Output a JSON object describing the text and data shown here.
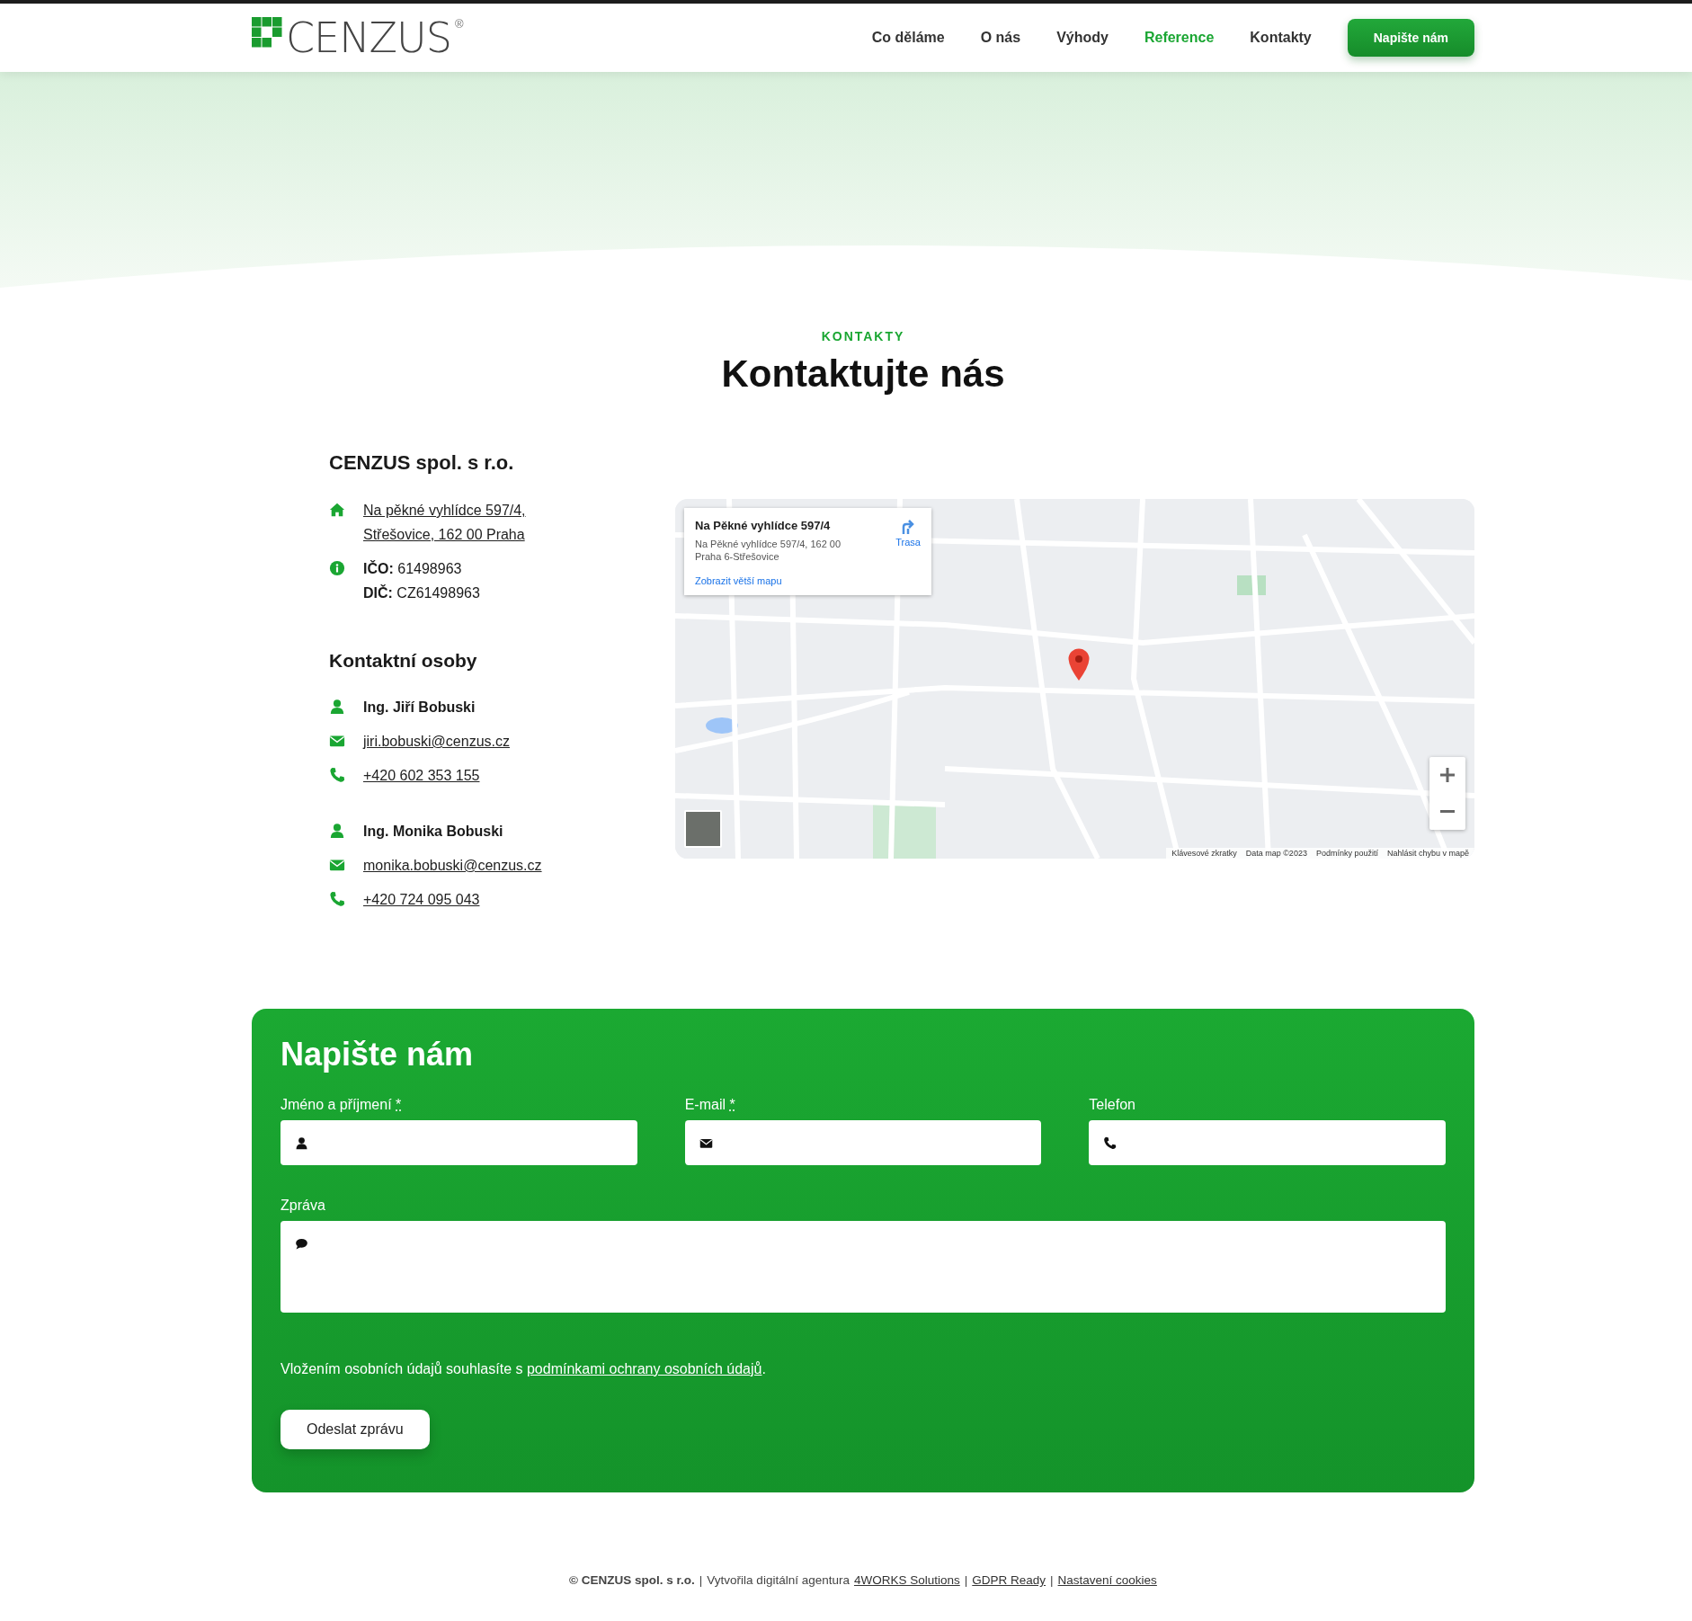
{
  "header": {
    "logo": {
      "text": "CENZUS",
      "mark": "®"
    },
    "nav": [
      {
        "label": "Co děláme",
        "selected": false
      },
      {
        "label": "O nás",
        "selected": false
      },
      {
        "label": "Výhody",
        "selected": false
      },
      {
        "label": "Reference",
        "selected": true
      },
      {
        "label": "Kontakty",
        "selected": false
      }
    ],
    "cta": "Napište nám"
  },
  "section": {
    "eyebrow": "KONTAKTY",
    "title": "Kontaktujte nás"
  },
  "company": {
    "name": "CENZUS spol. s r.o.",
    "address": [
      "Na pěkné vyhlídce 597/4,",
      "Střešovice, 162 00 Praha"
    ],
    "ids": [
      {
        "label": "IČO:",
        "value": "61498963"
      },
      {
        "label": "DIČ:",
        "value": "CZ61498963"
      }
    ]
  },
  "contacts": {
    "title": "Kontaktní osoby",
    "people": [
      {
        "name": "Ing. Jiří Bobuski",
        "email": "jiri.bobuski@cenzus.cz",
        "phone": "+420 602 353 155"
      },
      {
        "name": "Ing. Monika Bobuski",
        "email": "monika.bobuski@cenzus.cz",
        "phone": "+420 724 095 043"
      }
    ]
  },
  "map": {
    "card": {
      "title": "Na Pěkné vyhlídce 597/4",
      "address": [
        "Na Pěkné vyhlídce 597/4, 162 00",
        "Praha 6-Střešovice"
      ],
      "directions": "Trasa",
      "link": "Zobrazit větší mapu"
    },
    "attribution": [
      "Klávesové zkratky",
      "Data map ©2023",
      "Podmínky použití",
      "Nahlásit chybu v mapě"
    ]
  },
  "form": {
    "title": "Napište nám",
    "fields": [
      {
        "label": "Jméno a příjmení",
        "mark": "*",
        "kind": "name"
      },
      {
        "label": "E-mail",
        "mark": "*",
        "kind": "email"
      },
      {
        "label": "Telefon",
        "kind": "phone"
      }
    ],
    "message": {
      "label": "Zpráva"
    },
    "consent": {
      "text": "Vložením osobních údajů souhlasíte s",
      "link": "podmínkami ochrany osobních údajů",
      "end": "."
    },
    "submit": "Odeslat zprávu"
  },
  "footer": [
    {
      "kind": "bold",
      "text": "© CENZUS spol. s r.o."
    },
    {
      "kind": "sep",
      "text": "|"
    },
    {
      "kind": "text",
      "text": "Vytvořila digitální agentura"
    },
    {
      "kind": "link",
      "text": "4WORKS Solutions"
    },
    {
      "kind": "sep",
      "text": "|"
    },
    {
      "kind": "link",
      "text": "GDPR Ready"
    },
    {
      "kind": "sep",
      "text": "|"
    },
    {
      "kind": "link",
      "text": "Nastavení cookies"
    }
  ]
}
